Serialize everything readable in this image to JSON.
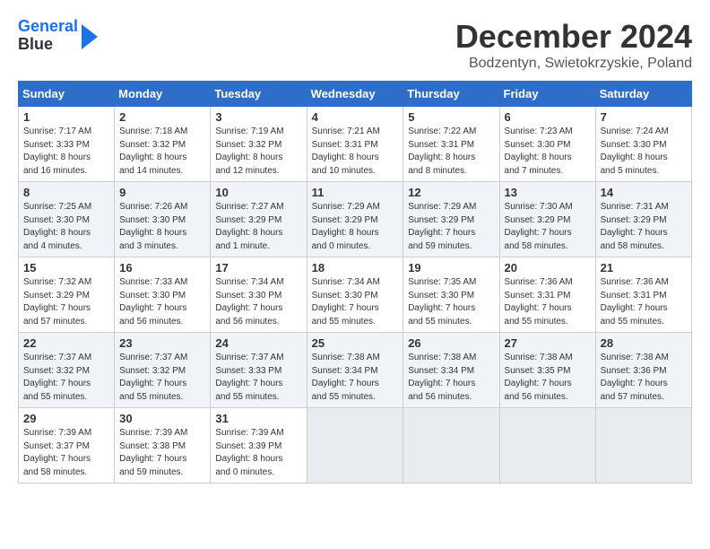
{
  "header": {
    "logo_line1": "General",
    "logo_line2": "Blue",
    "month_title": "December 2024",
    "location": "Bodzentyn, Swietokrzyskie, Poland"
  },
  "days_of_week": [
    "Sunday",
    "Monday",
    "Tuesday",
    "Wednesday",
    "Thursday",
    "Friday",
    "Saturday"
  ],
  "weeks": [
    [
      {
        "day": "1",
        "info": "Sunrise: 7:17 AM\nSunset: 3:33 PM\nDaylight: 8 hours\nand 16 minutes."
      },
      {
        "day": "2",
        "info": "Sunrise: 7:18 AM\nSunset: 3:32 PM\nDaylight: 8 hours\nand 14 minutes."
      },
      {
        "day": "3",
        "info": "Sunrise: 7:19 AM\nSunset: 3:32 PM\nDaylight: 8 hours\nand 12 minutes."
      },
      {
        "day": "4",
        "info": "Sunrise: 7:21 AM\nSunset: 3:31 PM\nDaylight: 8 hours\nand 10 minutes."
      },
      {
        "day": "5",
        "info": "Sunrise: 7:22 AM\nSunset: 3:31 PM\nDaylight: 8 hours\nand 8 minutes."
      },
      {
        "day": "6",
        "info": "Sunrise: 7:23 AM\nSunset: 3:30 PM\nDaylight: 8 hours\nand 7 minutes."
      },
      {
        "day": "7",
        "info": "Sunrise: 7:24 AM\nSunset: 3:30 PM\nDaylight: 8 hours\nand 5 minutes."
      }
    ],
    [
      {
        "day": "8",
        "info": "Sunrise: 7:25 AM\nSunset: 3:30 PM\nDaylight: 8 hours\nand 4 minutes."
      },
      {
        "day": "9",
        "info": "Sunrise: 7:26 AM\nSunset: 3:30 PM\nDaylight: 8 hours\nand 3 minutes."
      },
      {
        "day": "10",
        "info": "Sunrise: 7:27 AM\nSunset: 3:29 PM\nDaylight: 8 hours\nand 1 minute."
      },
      {
        "day": "11",
        "info": "Sunrise: 7:29 AM\nSunset: 3:29 PM\nDaylight: 8 hours\nand 0 minutes."
      },
      {
        "day": "12",
        "info": "Sunrise: 7:29 AM\nSunset: 3:29 PM\nDaylight: 7 hours\nand 59 minutes."
      },
      {
        "day": "13",
        "info": "Sunrise: 7:30 AM\nSunset: 3:29 PM\nDaylight: 7 hours\nand 58 minutes."
      },
      {
        "day": "14",
        "info": "Sunrise: 7:31 AM\nSunset: 3:29 PM\nDaylight: 7 hours\nand 58 minutes."
      }
    ],
    [
      {
        "day": "15",
        "info": "Sunrise: 7:32 AM\nSunset: 3:29 PM\nDaylight: 7 hours\nand 57 minutes."
      },
      {
        "day": "16",
        "info": "Sunrise: 7:33 AM\nSunset: 3:30 PM\nDaylight: 7 hours\nand 56 minutes."
      },
      {
        "day": "17",
        "info": "Sunrise: 7:34 AM\nSunset: 3:30 PM\nDaylight: 7 hours\nand 56 minutes."
      },
      {
        "day": "18",
        "info": "Sunrise: 7:34 AM\nSunset: 3:30 PM\nDaylight: 7 hours\nand 55 minutes."
      },
      {
        "day": "19",
        "info": "Sunrise: 7:35 AM\nSunset: 3:30 PM\nDaylight: 7 hours\nand 55 minutes."
      },
      {
        "day": "20",
        "info": "Sunrise: 7:36 AM\nSunset: 3:31 PM\nDaylight: 7 hours\nand 55 minutes."
      },
      {
        "day": "21",
        "info": "Sunrise: 7:36 AM\nSunset: 3:31 PM\nDaylight: 7 hours\nand 55 minutes."
      }
    ],
    [
      {
        "day": "22",
        "info": "Sunrise: 7:37 AM\nSunset: 3:32 PM\nDaylight: 7 hours\nand 55 minutes."
      },
      {
        "day": "23",
        "info": "Sunrise: 7:37 AM\nSunset: 3:32 PM\nDaylight: 7 hours\nand 55 minutes."
      },
      {
        "day": "24",
        "info": "Sunrise: 7:37 AM\nSunset: 3:33 PM\nDaylight: 7 hours\nand 55 minutes."
      },
      {
        "day": "25",
        "info": "Sunrise: 7:38 AM\nSunset: 3:34 PM\nDaylight: 7 hours\nand 55 minutes."
      },
      {
        "day": "26",
        "info": "Sunrise: 7:38 AM\nSunset: 3:34 PM\nDaylight: 7 hours\nand 56 minutes."
      },
      {
        "day": "27",
        "info": "Sunrise: 7:38 AM\nSunset: 3:35 PM\nDaylight: 7 hours\nand 56 minutes."
      },
      {
        "day": "28",
        "info": "Sunrise: 7:38 AM\nSunset: 3:36 PM\nDaylight: 7 hours\nand 57 minutes."
      }
    ],
    [
      {
        "day": "29",
        "info": "Sunrise: 7:39 AM\nSunset: 3:37 PM\nDaylight: 7 hours\nand 58 minutes."
      },
      {
        "day": "30",
        "info": "Sunrise: 7:39 AM\nSunset: 3:38 PM\nDaylight: 7 hours\nand 59 minutes."
      },
      {
        "day": "31",
        "info": "Sunrise: 7:39 AM\nSunset: 3:39 PM\nDaylight: 8 hours\nand 0 minutes."
      },
      {
        "day": "",
        "info": ""
      },
      {
        "day": "",
        "info": ""
      },
      {
        "day": "",
        "info": ""
      },
      {
        "day": "",
        "info": ""
      }
    ]
  ]
}
